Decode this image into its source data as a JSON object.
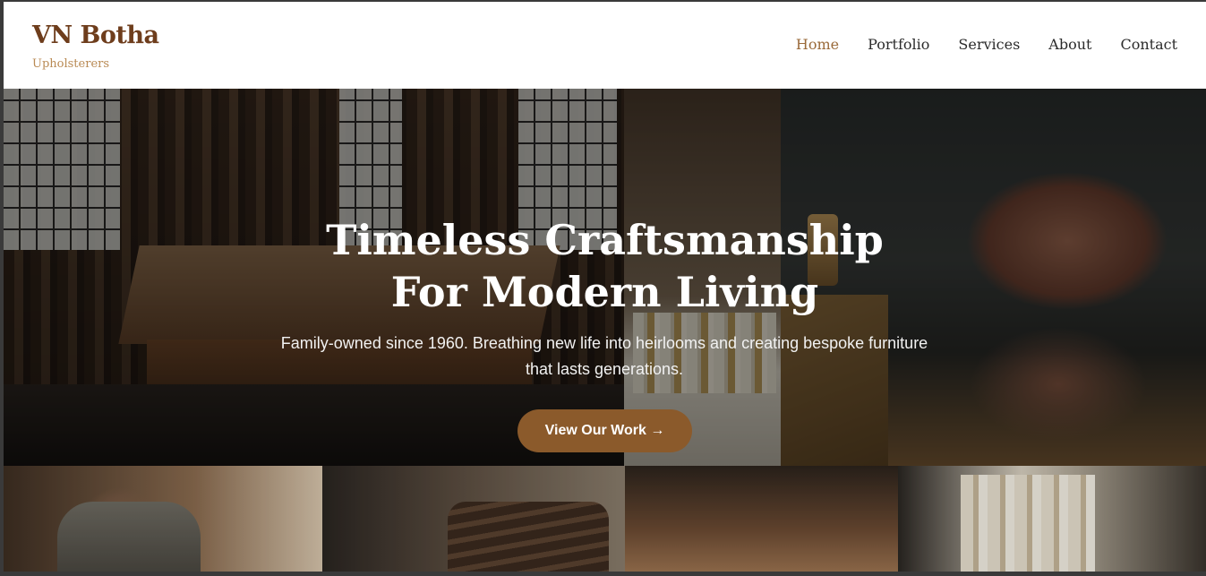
{
  "brand": {
    "name": "VN Botha",
    "tagline": "Upholsterers"
  },
  "nav": {
    "items": [
      {
        "label": "Home",
        "active": true
      },
      {
        "label": "Portfolio",
        "active": false
      },
      {
        "label": "Services",
        "active": false
      },
      {
        "label": "About",
        "active": false
      },
      {
        "label": "Contact",
        "active": false
      }
    ]
  },
  "hero": {
    "title_line1": "Timeless Craftsmanship",
    "title_line2": "For Modern Living",
    "subtitle": "Family-owned since 1960. Breathing new life into heirlooms and creating bespoke furniture that lasts generations.",
    "cta_label": "View Our Work →"
  },
  "colors": {
    "brand": "#6e3d1c",
    "accent": "#8b5a2b",
    "nav_active": "#9a6a3a",
    "tagline": "#b98a54"
  }
}
